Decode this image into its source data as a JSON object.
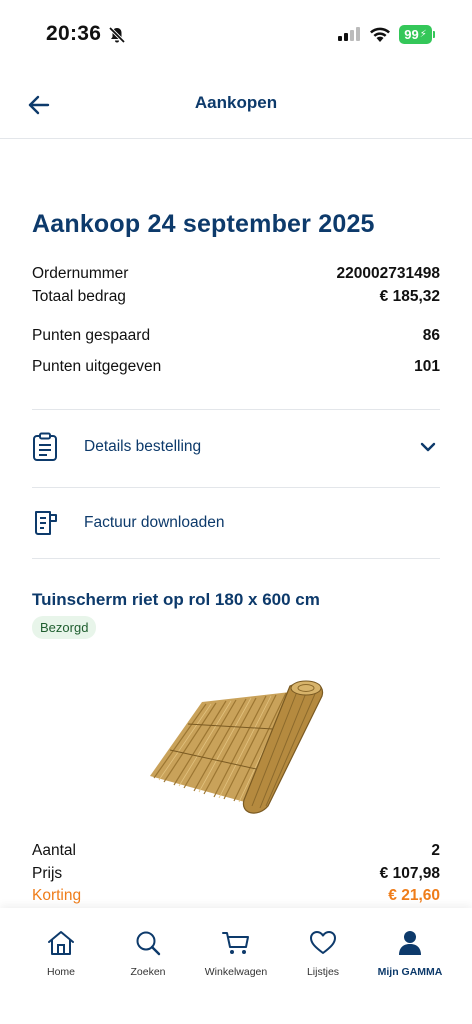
{
  "status_bar": {
    "time": "20:36",
    "battery": "99"
  },
  "header": {
    "title": "Aankopen"
  },
  "purchase": {
    "title": "Aankoop 24 september 2025",
    "rows": [
      {
        "label": "Ordernummer",
        "value": "220002731498"
      },
      {
        "label": "Totaal bedrag",
        "value": "€ 185,32"
      },
      {
        "label": "Punten gespaard",
        "value": "86"
      },
      {
        "label": "Punten uitgegeven",
        "value": "101"
      }
    ]
  },
  "actions": {
    "details_label": "Details bestelling",
    "invoice_label": "Factuur downloaden"
  },
  "product": {
    "title": "Tuinscherm riet op rol 180 x 600 cm",
    "status": "Bezorgd",
    "rows": [
      {
        "label": "Aantal",
        "value": "2"
      },
      {
        "label": "Prijs",
        "value": "€ 107,98"
      },
      {
        "label": "Korting",
        "value": "€ 21,60"
      }
    ]
  },
  "bottom_nav": {
    "items": [
      {
        "label": "Home",
        "icon": "home-icon"
      },
      {
        "label": "Zoeken",
        "icon": "search-icon"
      },
      {
        "label": "Winkelwagen",
        "icon": "cart-icon"
      },
      {
        "label": "Lijstjes",
        "icon": "heart-icon"
      },
      {
        "label": "Mijn GAMMA",
        "icon": "user-icon"
      }
    ],
    "active": "Mijn GAMMA"
  },
  "colors": {
    "brand_blue": "#0d3a6b",
    "discount_orange": "#ef7d1a",
    "badge_green_bg": "#e8f5ea",
    "battery_green": "#34c759"
  }
}
